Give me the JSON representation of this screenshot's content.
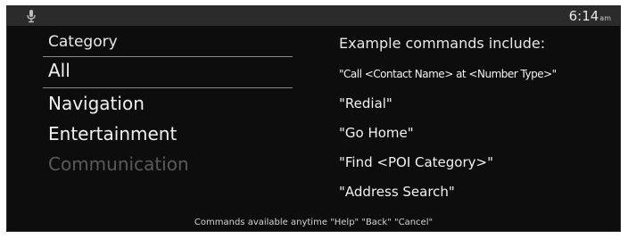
{
  "status_bar": {
    "mic_icon": "microphone-icon",
    "time": "6:14",
    "ampm": "am"
  },
  "category_panel": {
    "header": "Category",
    "items": [
      {
        "label": "All",
        "state": "selected"
      },
      {
        "label": "Navigation",
        "state": "normal"
      },
      {
        "label": "Entertainment",
        "state": "normal"
      },
      {
        "label": "Communication",
        "state": "disabled"
      }
    ]
  },
  "examples_panel": {
    "header": "Example commands include:",
    "commands": [
      "\"Call <Contact Name> at <Number Type>\"",
      "\"Redial\"",
      "\"Go Home\"",
      "\"Find <POI Category>\"",
      "\"Address Search\""
    ]
  },
  "footer": {
    "text": "Commands available anytime \"Help\" \"Back\" \"Cancel\""
  },
  "colors": {
    "screen_bg": "#0d0d0d",
    "status_bar_bg": "#2b2b2b",
    "text": "#f0f0f0",
    "disabled_text": "#5a5a5a",
    "divider": "#8a8a8a"
  }
}
